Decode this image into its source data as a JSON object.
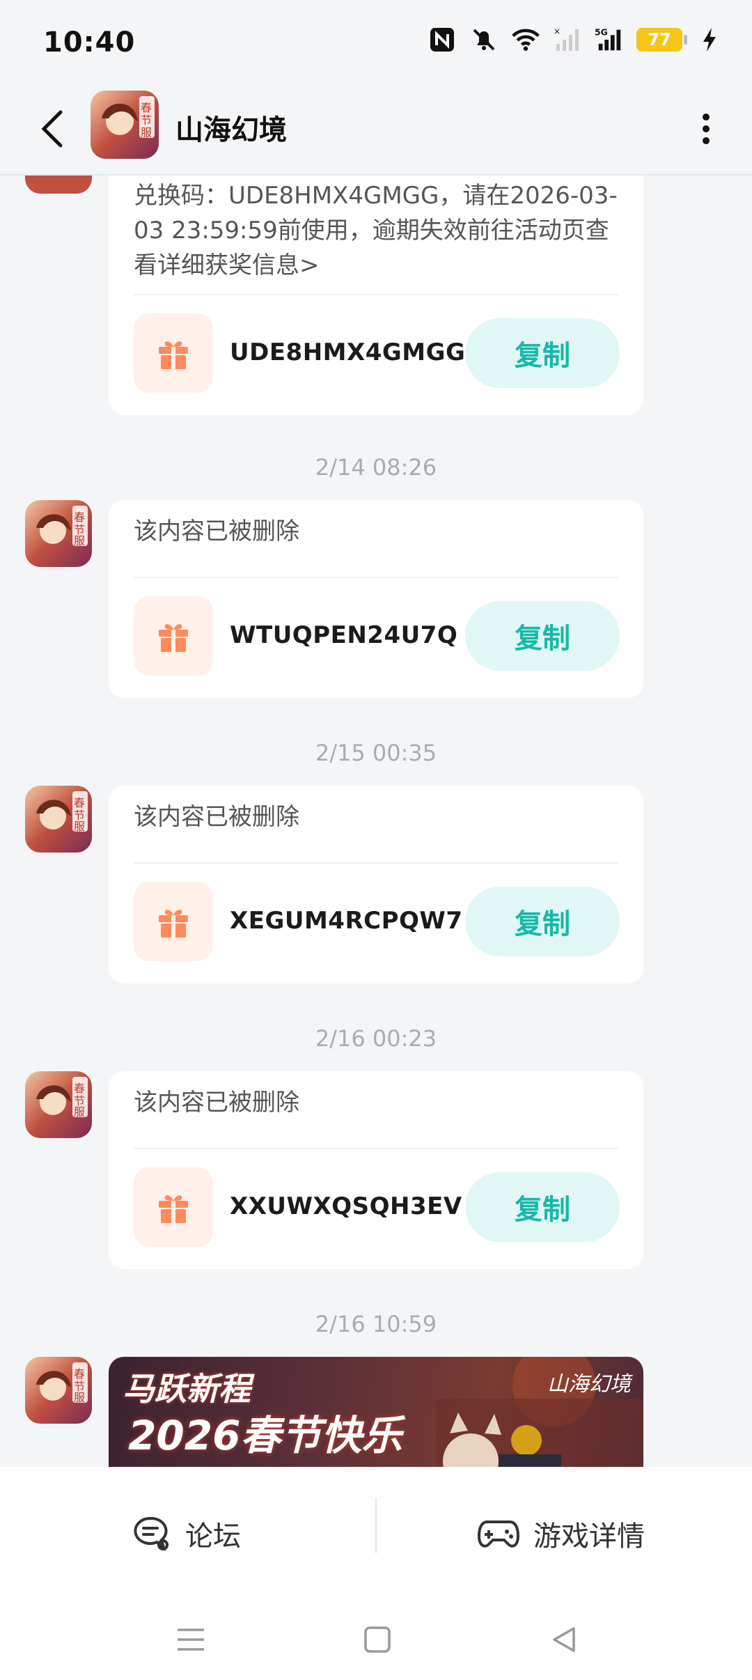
{
  "status": {
    "time": "10:40",
    "battery": "77"
  },
  "header": {
    "title": "山海幻境"
  },
  "messages": [
    {
      "text": "兑换码：UDE8HMX4GMGG，请在2026-03-03 23:59:59前使用，逾期失效前往活动页查看详细获奖信息>",
      "code": "UDE8HMX4GMGG",
      "copy": "复制"
    },
    {
      "time": "2/14  08:26",
      "text": "该内容已被删除",
      "code": "WTUQPEN24U7Q",
      "copy": "复制"
    },
    {
      "time": "2/15  00:35",
      "text": "该内容已被删除",
      "code": "XEGUM4RCPQW7",
      "copy": "复制"
    },
    {
      "time": "2/16  00:23",
      "text": "该内容已被删除",
      "code": "XXUWXQSQH3EV",
      "copy": "复制"
    },
    {
      "time": "2/16  10:59",
      "banner_line1": "马跃新程",
      "banner_line2": "2026春节快乐",
      "banner_logo": "山海幻境"
    }
  ],
  "bottom_nav": {
    "forum": "论坛",
    "game_detail": "游戏详情"
  }
}
